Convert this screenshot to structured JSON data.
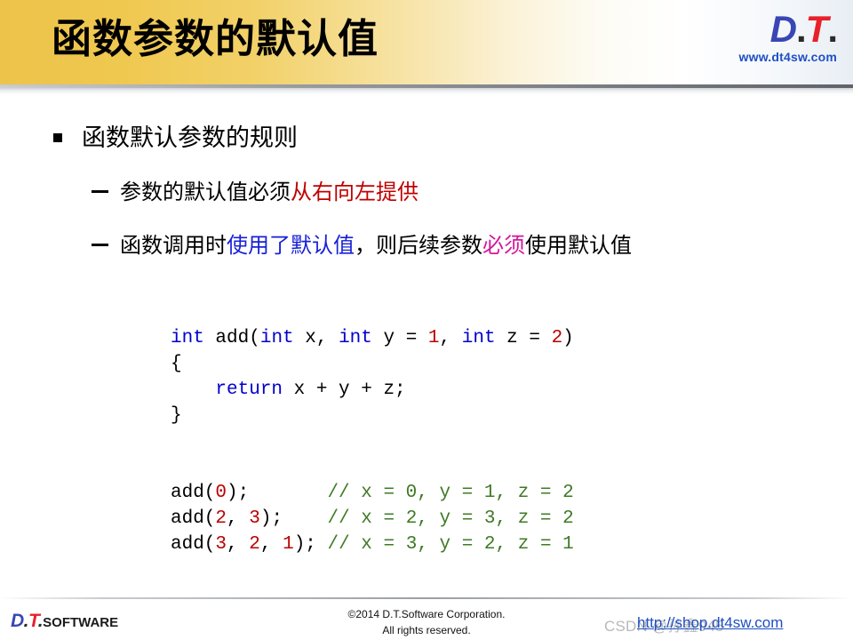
{
  "header": {
    "title": "函数参数的默认值",
    "logo": {
      "d": "D",
      "dot1": ".",
      "t": "T",
      "dot2": ".",
      "url": "www.dt4sw.com"
    }
  },
  "content": {
    "bullet1": "函数默认参数的规则",
    "bullet2": {
      "part1": "参数的默认值必须",
      "highlight_red": "从右向左提供"
    },
    "bullet3": {
      "part1": "函数调用时",
      "highlight_blue": "使用了默认值",
      "part2": "，则后续参数",
      "highlight_magenta": "必须",
      "part3": "使用默认值"
    }
  },
  "code": {
    "line1": {
      "kw1": "int",
      "sp1": " ",
      "name": "add(",
      "kw2": "int",
      "arg1": " x, ",
      "kw3": "int",
      "arg2": " y = ",
      "num1": "1",
      "arg3": ", ",
      "kw4": "int",
      "arg4": " z = ",
      "num2": "2",
      "close": ")"
    },
    "line2": "{",
    "line3": {
      "kw": "    return",
      "rest": " x + y + z;"
    },
    "line4": "}",
    "line5": {
      "call": "add(",
      "num": "0",
      "tail": ");       ",
      "comment": "// x = 0, y = 1, z = 2"
    },
    "line6": {
      "call": "add(",
      "num1": "2",
      "mid": ", ",
      "num2": "3",
      "tail": ");    ",
      "comment": "// x = 2, y = 3, z = 2"
    },
    "line7": {
      "call": "add(",
      "num1": "3",
      "mid1": ", ",
      "num2": "2",
      "mid2": ", ",
      "num3": "1",
      "tail": "); ",
      "comment": "// x = 3, y = 2, z = 1"
    }
  },
  "footer": {
    "logo": {
      "d": "D",
      "dot1": ".",
      "t": "T",
      "dot2": ".",
      "word": "SOFTWARE"
    },
    "copyright_line1": "©2014 D.T.Software Corporation.",
    "copyright_line2": "All rights reserved.",
    "watermark": "CSDN @孙鑫945",
    "link": "http://shop.dt4sw.com"
  },
  "colors": {
    "header_gold": "#eec34a",
    "accent_blue": "#3a46b4",
    "accent_red": "#e8202a",
    "link_blue": "#1f4fc4",
    "code_keyword": "#0000cc",
    "code_number": "#bb0000",
    "code_comment": "#3f7a24",
    "hl_red": "#c00000",
    "hl_blue": "#1821d6",
    "hl_magenta": "#d4179b"
  }
}
